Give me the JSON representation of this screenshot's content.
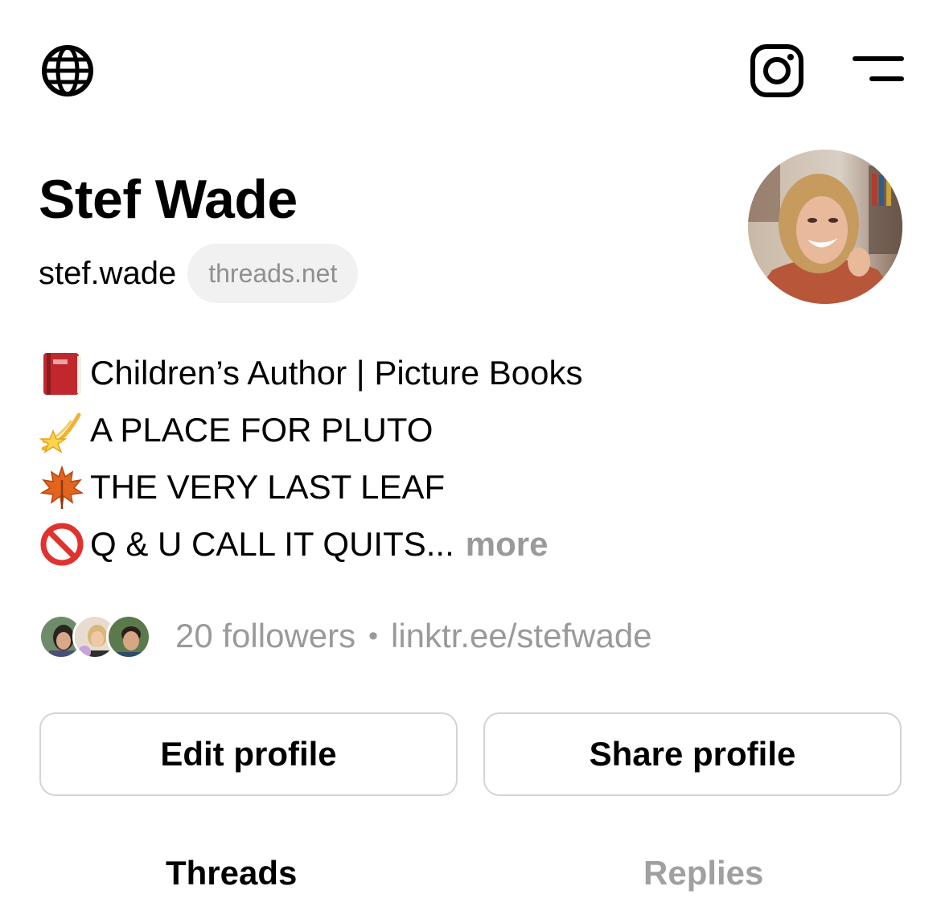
{
  "header": {
    "left_icon": "globe-icon",
    "right_icons": [
      "instagram-icon",
      "menu-icon"
    ]
  },
  "profile": {
    "name": "Stef Wade",
    "handle": "stef.wade",
    "domain_badge": "threads.net",
    "avatar": "profile-photo"
  },
  "bio": {
    "lines": [
      {
        "emoji": "red-book-icon",
        "text": "Children’s Author | Picture Books"
      },
      {
        "emoji": "dizzy-star-icon",
        "text": "A PLACE FOR PLUTO"
      },
      {
        "emoji": "maple-leaf-icon",
        "text": "THE VERY LAST LEAF"
      },
      {
        "emoji": "prohibited-icon",
        "text": "Q & U CALL IT QUITS..."
      }
    ],
    "more_label": "more"
  },
  "meta": {
    "followers": "20 followers",
    "separator": "•",
    "link": "linktr.ee/stefwade"
  },
  "actions": {
    "edit_label": "Edit profile",
    "share_label": "Share profile"
  },
  "tabs": [
    {
      "label": "Threads",
      "active": true
    },
    {
      "label": "Replies",
      "active": false
    }
  ],
  "colors": {
    "muted_text": "#9a9a9a",
    "pill_bg": "#f1f1f1",
    "button_border": "#d4d4d4"
  }
}
